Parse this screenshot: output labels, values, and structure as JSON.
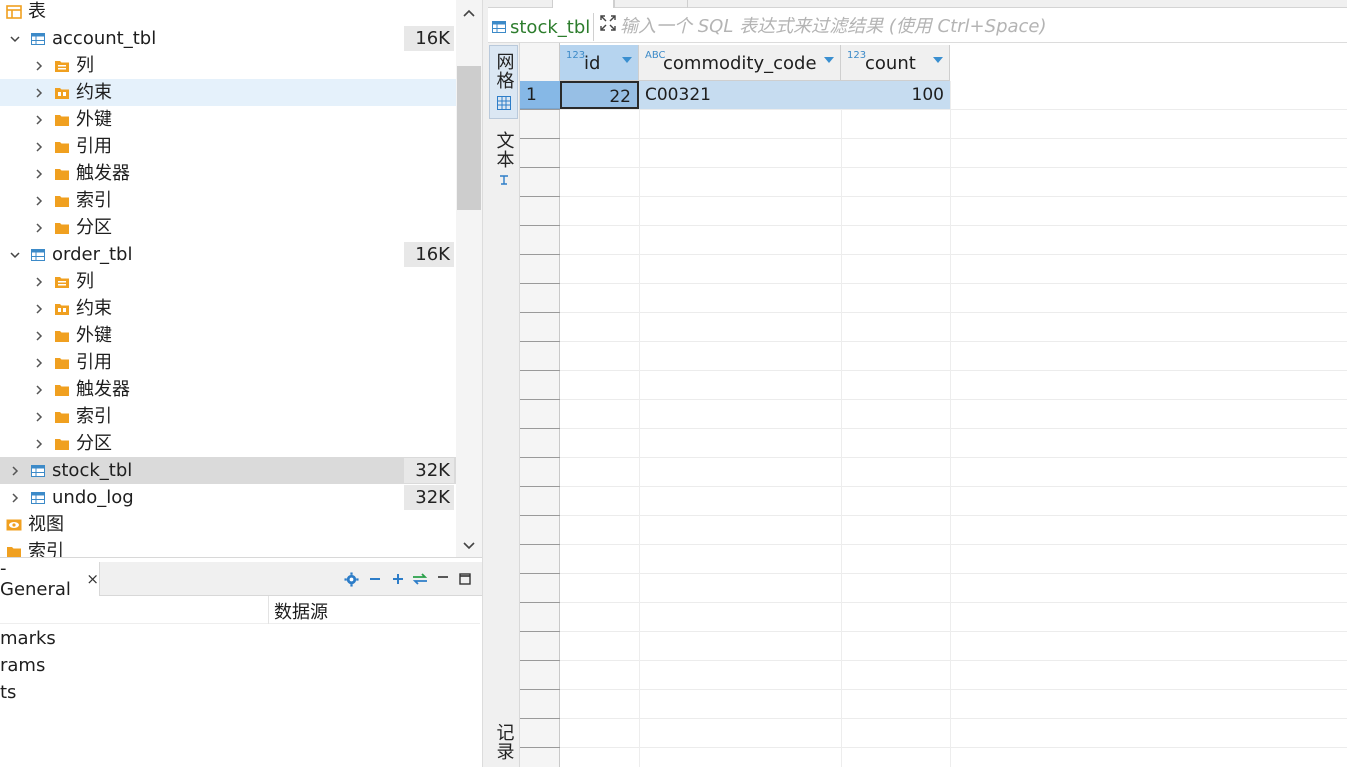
{
  "navigator": {
    "tables_folder_label": "表",
    "tables": [
      {
        "name": "account_tbl",
        "size": "16K",
        "children": [
          "列",
          "约束",
          "外键",
          "引用",
          "触发器",
          "索引",
          "分区"
        ]
      },
      {
        "name": "order_tbl",
        "size": "16K",
        "children": [
          "列",
          "约束",
          "外键",
          "引用",
          "触发器",
          "索引",
          "分区"
        ]
      },
      {
        "name": "stock_tbl",
        "size": "32K"
      },
      {
        "name": "undo_log",
        "size": "32K"
      }
    ],
    "views_folder_label": "视图",
    "indexes_folder_label": "索引"
  },
  "properties": {
    "tab_label": "- General",
    "close_glyph": "×",
    "column_header": "数据源",
    "rows": [
      "marks",
      "rams",
      "ts"
    ]
  },
  "editor": {
    "table_chip": "stock_tbl",
    "filter_placeholder": "输入一个 SQL 表达式来过滤结果 (使用 Ctrl+Space)",
    "side_tabs": {
      "grid": "网格",
      "text": "文本",
      "record": "记录"
    },
    "columns": [
      {
        "name": "id",
        "type_glyph": "123"
      },
      {
        "name": "commodity_code",
        "type_glyph": "ABC"
      },
      {
        "name": "count",
        "type_glyph": "123"
      }
    ],
    "rows": [
      {
        "rownum": "1",
        "id": "22",
        "commodity_code": "C00321",
        "count": "100"
      }
    ]
  },
  "colors": {
    "folder_orange": "#f0a020",
    "table_blue": "#3c8ac8",
    "selection_blue": "#97bfe5",
    "green_text": "#2d7d2d"
  }
}
